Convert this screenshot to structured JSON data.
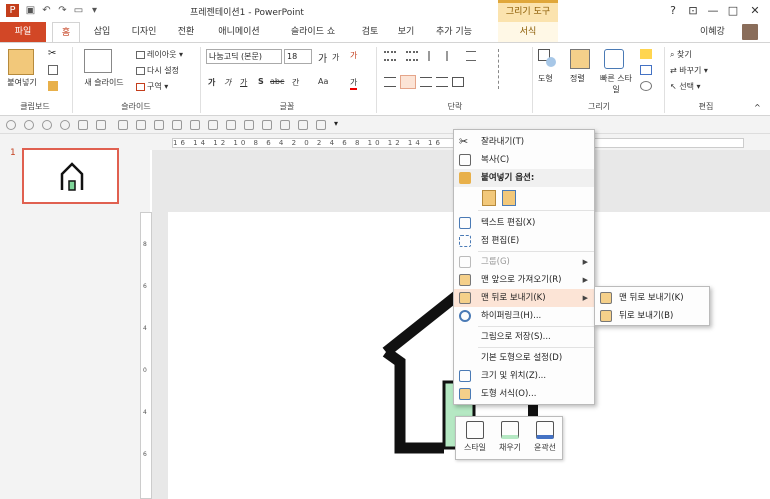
{
  "window": {
    "title": "프레젠테이션1 - PowerPoint",
    "context_tab_group": "그리기 도구",
    "help": "?",
    "minimize": "—",
    "restore": "□",
    "close": "✕",
    "user_name": "이혜강"
  },
  "tabs": {
    "file": "파일",
    "home": "홈",
    "insert": "삽입",
    "design": "디자인",
    "transitions": "전환",
    "animations": "애니메이션",
    "slideshow": "슬라이드 쇼",
    "review": "검토",
    "view": "보기",
    "addins": "추가 기능",
    "format": "서식"
  },
  "ribbon": {
    "clipboard": {
      "paste": "붙여넣기",
      "label": "클립보드"
    },
    "slides": {
      "new_slide": "새 슬라이드",
      "layout": "레이아웃 ▾",
      "reset": "다시 설정",
      "section": "구역 ▾",
      "label": "슬라이드"
    },
    "font": {
      "font_name": "나눔고딕 (본문)",
      "font_size": "18",
      "grow": "가",
      "shrink": "가",
      "clear": "가",
      "bold": "가",
      "italic": "가",
      "underline": "가",
      "shadow": "S",
      "strike": "abc",
      "spacing": "간",
      "case": "Aa",
      "color": "가",
      "label": "글꼴"
    },
    "paragraph": {
      "label": "단락"
    },
    "drawing": {
      "shapes": "도형",
      "arrange": "정렬",
      "quick_styles": "빠른 스타일",
      "label": "그리기"
    },
    "editing": {
      "find": "찾기",
      "replace": "바꾸기 ▾",
      "select": "선택 ▾",
      "label": "편집"
    }
  },
  "slides_pane": {
    "slide_number": "1"
  },
  "ruler": {
    "ticks": "16 14 12 10 8 6 4 2 0 2 4 6 8 10 12 14 16"
  },
  "vruler": {
    "ticks": [
      "8",
      "6",
      "4",
      "2",
      "0",
      "2",
      "4",
      "6"
    ]
  },
  "context_menu": {
    "cut": "잘라내기(T)",
    "copy": "복사(C)",
    "paste_options": "붙여넣기 옵션:",
    "edit_text": "텍스트 편집(X)",
    "edit_points": "점 편집(E)",
    "group": "그룹(G)",
    "bring_to_front": "맨 앞으로 가져오기(R)",
    "send_to_back": "맨 뒤로 보내기(K)",
    "hyperlink": "하이퍼링크(H)...",
    "save_as_picture": "그림으로 저장(S)...",
    "set_default": "기본 도형으로 설정(D)",
    "size_position": "크기 및 위치(Z)...",
    "format_shape": "도형 서식(O)..."
  },
  "submenu": {
    "send_to_back": "맨 뒤로 보내기(K)",
    "send_backward": "뒤로 보내기(B)"
  },
  "mini_toolbar": {
    "style": "스타일",
    "fill": "채우기",
    "outline": "윤곽선"
  },
  "colors": {
    "file_tab": "#d24726",
    "accent": "#c43e1c",
    "highlight": "#fce4d6",
    "context_tab": "#fbe3ae",
    "house_fill": "#b5e8c3"
  }
}
